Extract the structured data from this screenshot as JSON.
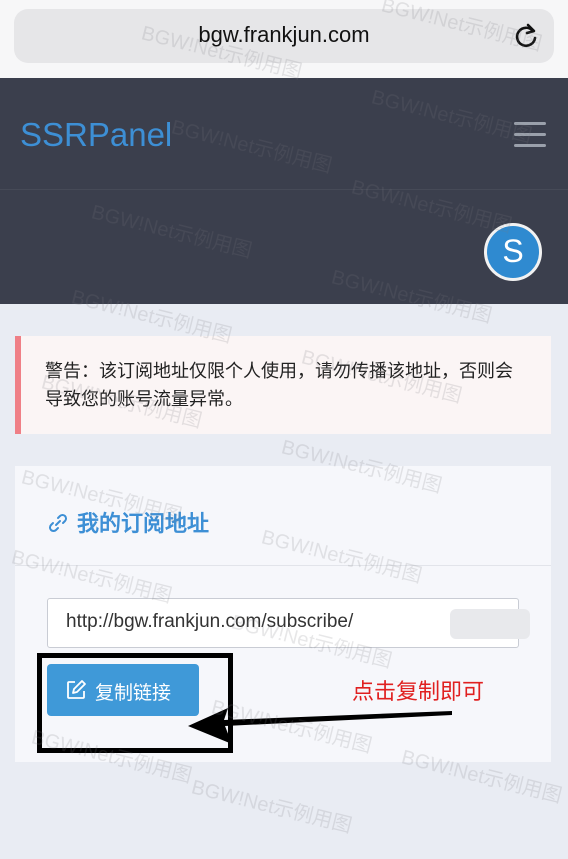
{
  "browser": {
    "url": "bgw.frankjun.com",
    "reload_icon": "reload-icon"
  },
  "header": {
    "brand": "SSRPanel",
    "menu_icon": "hamburger-menu-icon",
    "avatar_letter": "S"
  },
  "alert": {
    "text": "警告：该订阅地址仅限个人使用，请勿传播该地址，否则会导致您的账号流量异常。"
  },
  "subscription": {
    "title": "我的订阅地址",
    "title_icon": "link-icon",
    "url_value": "http://bgw.frankjun.com/subscribe/",
    "copy_button_label": "复制链接",
    "copy_icon": "edit-icon"
  },
  "annotation": {
    "text": "点击复制即可"
  },
  "watermark": {
    "text": "BGW!Net示例用图"
  },
  "colors": {
    "accent": "#3d8fd5",
    "header_bg": "#3b3f4d",
    "alert_border": "#ef7f86",
    "annotation_red": "#e02020"
  }
}
